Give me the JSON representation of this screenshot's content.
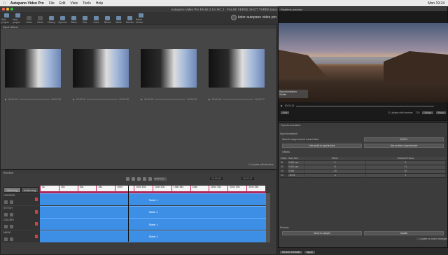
{
  "menubar": {
    "apple": "",
    "app": "Autopano Video Pro",
    "items": [
      "File",
      "Edit",
      "View",
      "Tools",
      "Help"
    ],
    "clock": "Mon 19:24"
  },
  "window": {
    "title": "Autopano Video Pro EN.kit 2.5.0 RC 2 - FALSE VERSE SHOT THREE.kava"
  },
  "toolbar": {
    "items": [
      "Add project",
      "New project",
      "Undo",
      "Redo",
      "History",
      "Synchro",
      "Stitch",
      "Blur",
      "Color",
      "Blend",
      "Mask",
      "Render",
      "Batch render"
    ],
    "brand": "kolor autopano video pro"
  },
  "input_videos": {
    "header": "Input videos",
    "videos": [
      {
        "time_start": "00:01:15",
        "time_end": "00:03:26"
      },
      {
        "time_start": "00:01:15",
        "time_end": "00:03:26"
      },
      {
        "time_start": "00:01:15",
        "time_end": "00:03:26"
      },
      {
        "time_start": "00:01:15",
        "time_end": "00:03:27"
      }
    ],
    "sync_checkbox": "Update with timeline"
  },
  "timeline": {
    "header": "Timeline",
    "time_left": "00:00:00",
    "time_right": "00:03:07",
    "zoom_select": "Linear pos",
    "tabs": [
      "Stitching",
      "Authoring"
    ],
    "ruler": [
      "0s",
      "15s",
      "30s",
      "45s",
      "1min",
      "1min 15s",
      "1min 30s",
      "1min 45s",
      "2min",
      "2min 15s",
      "2min 30s",
      "2min 45s"
    ],
    "tracks": [
      {
        "name": "HORIZON",
        "clip": "State 1"
      },
      {
        "name": "STITCH",
        "clip": "State 1"
      },
      {
        "name": "COLORS",
        "clip": "State 1"
      },
      {
        "name": "MASK",
        "clip": "State 1"
      }
    ]
  },
  "preview": {
    "header": "Realtime preview",
    "overlay_line1": "Synchronization",
    "overlay_line2": "Visible",
    "time": "00:01:15",
    "button_left": "Edit",
    "update_label": "Update with timeline",
    "fps": "720",
    "button_right": "Setup",
    "button_right2": "Redo"
  },
  "synchronization": {
    "header": "Synchronization",
    "section": "Synchronization",
    "search_label": "Search range around current time",
    "search_value": "00:00:1",
    "btn_audio": "Use audio to synchronize",
    "btn_motion": "Use motion to synchronize",
    "offsets_label": "Offsets",
    "table_headers": [
      "Video",
      "Start time",
      "Offset",
      "Selected Frame"
    ],
    "rows": [
      {
        "video": "01",
        "start": "0.000 sec",
        "offset": "0",
        "frame": "0"
      },
      {
        "video": "02",
        "start": "0.000 sec",
        "offset": "+1",
        "frame": "+1"
      },
      {
        "video": "03",
        "start": "0.063",
        "offset": "-10",
        "frame": "10"
      },
      {
        "video": "04",
        "start": "-10.04",
        "offset": "-1",
        "frame": "1"
      }
    ],
    "preview_label": "Preview",
    "btn_apply": "Move to sample",
    "btn_update": "Update",
    "auto_label": "Update on batch changes"
  },
  "footer": {
    "restore": "Restore Defaults",
    "apply": "Apply"
  }
}
